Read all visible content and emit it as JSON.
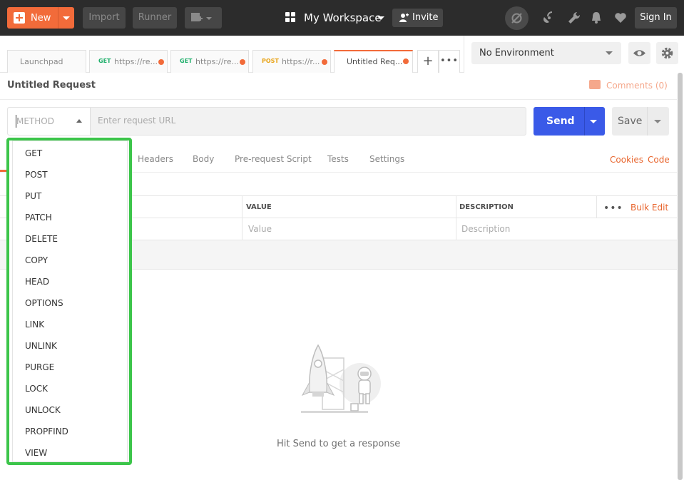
{
  "topbar": {
    "new_label": "New",
    "import_label": "Import",
    "runner_label": "Runner",
    "workspace_label": "My Workspace",
    "invite_label": "Invite",
    "signin_label": "Sign In"
  },
  "tabs": [
    {
      "method": "",
      "label": "Launchpad"
    },
    {
      "method": "GET",
      "label": "https://re..."
    },
    {
      "method": "GET",
      "label": "https://re..."
    },
    {
      "method": "POST",
      "label": "https://r..."
    },
    {
      "method": "",
      "label": "Untitled Req..."
    }
  ],
  "colors": {
    "get": "#1faf6b",
    "post": "#e8a317",
    "accent": "#f26b3a",
    "send": "#3a5ae8",
    "dropdown_border": "#3cc54a"
  },
  "environment": {
    "selected": "No Environment"
  },
  "request": {
    "name": "Untitled Request",
    "comments_label": "Comments (0)",
    "method_placeholder": "METHOD",
    "url_placeholder": "Enter request URL",
    "send_label": "Send",
    "save_label": "Save"
  },
  "request_tabs": [
    "Headers",
    "Body",
    "Pre-request Script",
    "Tests",
    "Settings"
  ],
  "request_links": {
    "cookies": "Cookies",
    "code": "Code"
  },
  "params_table": {
    "headers": {
      "value": "VALUE",
      "description": "DESCRIPTION"
    },
    "bulk_edit": "Bulk Edit",
    "row_placeholders": {
      "value": "Value",
      "description": "Description"
    }
  },
  "response": {
    "hint": "Hit Send to get a response"
  },
  "method_options": [
    "GET",
    "POST",
    "PUT",
    "PATCH",
    "DELETE",
    "COPY",
    "HEAD",
    "OPTIONS",
    "LINK",
    "UNLINK",
    "PURGE",
    "LOCK",
    "UNLOCK",
    "PROPFIND",
    "VIEW"
  ]
}
